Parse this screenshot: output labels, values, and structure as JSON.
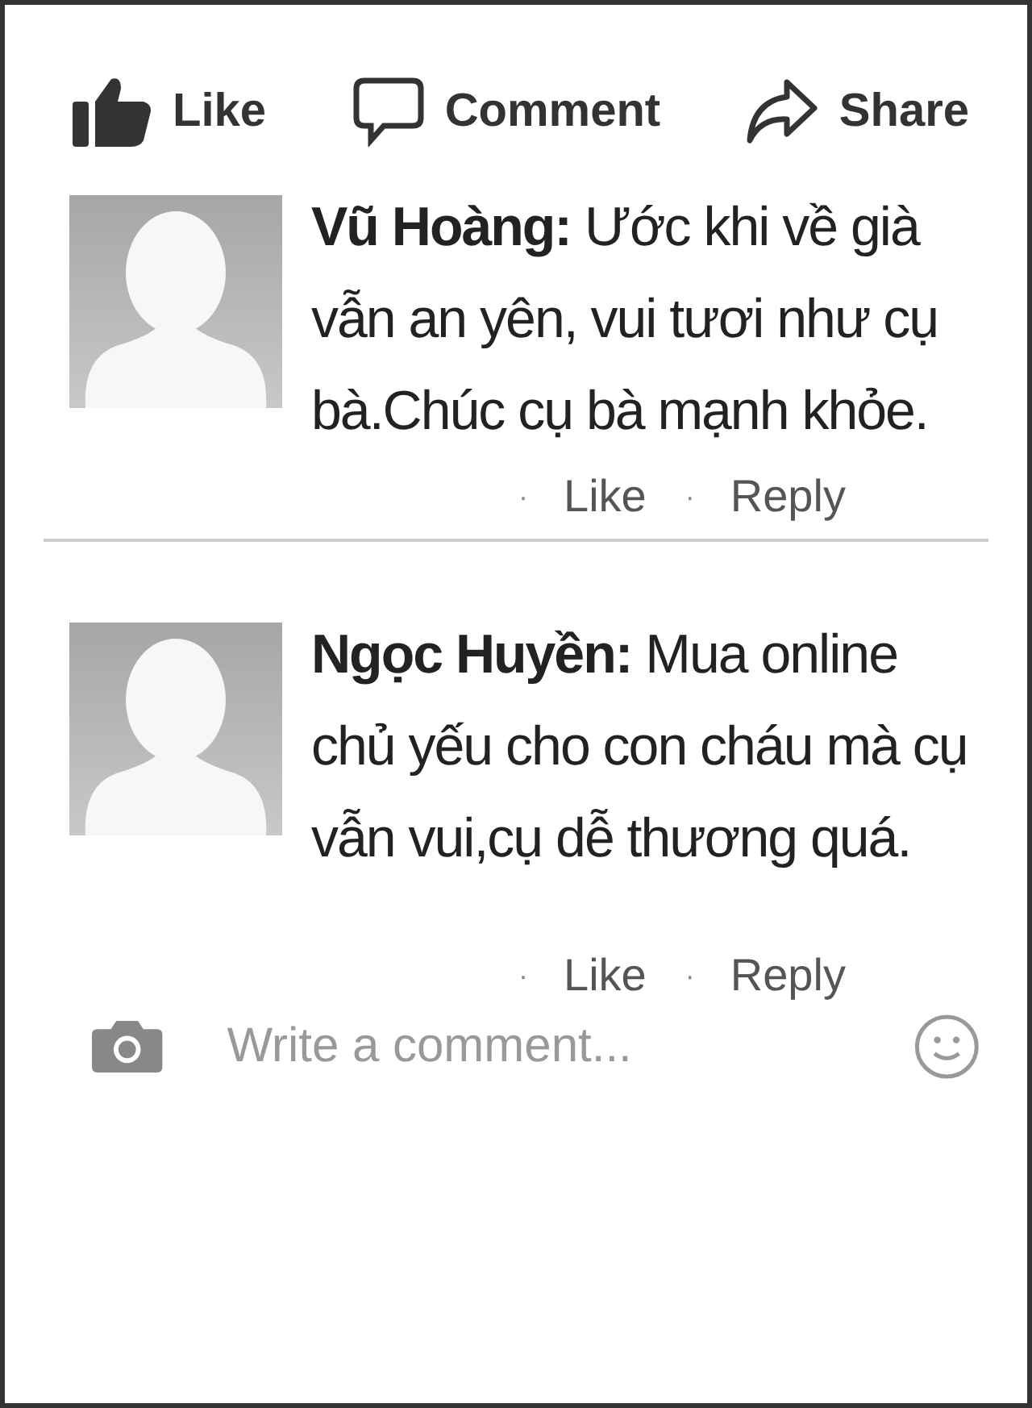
{
  "actions": [
    {
      "kind": "like",
      "label": "Like"
    },
    {
      "kind": "comment",
      "label": "Comment"
    },
    {
      "kind": "share",
      "label": "Share"
    }
  ],
  "comments": [
    {
      "author": "Vũ Hoàng:",
      "text": "Ước khi về già vẫn an yên, vui tươi như cụ bà.Chúc cụ bà mạnh khỏe.",
      "links": [
        {
          "bullet": "·",
          "label": "Like"
        },
        {
          "bullet": "·",
          "label": "Reply"
        }
      ]
    },
    {
      "author": "Ngọc Huyền:",
      "text": "Mua online chủ yếu cho con cháu mà cụ vẫn vui,cụ dễ thương quá.",
      "links": [
        {
          "bullet": "·",
          "label": "Like"
        },
        {
          "bullet": "·",
          "label": "Reply"
        }
      ]
    }
  ],
  "composer": {
    "placeholder": "Write a comment..."
  }
}
